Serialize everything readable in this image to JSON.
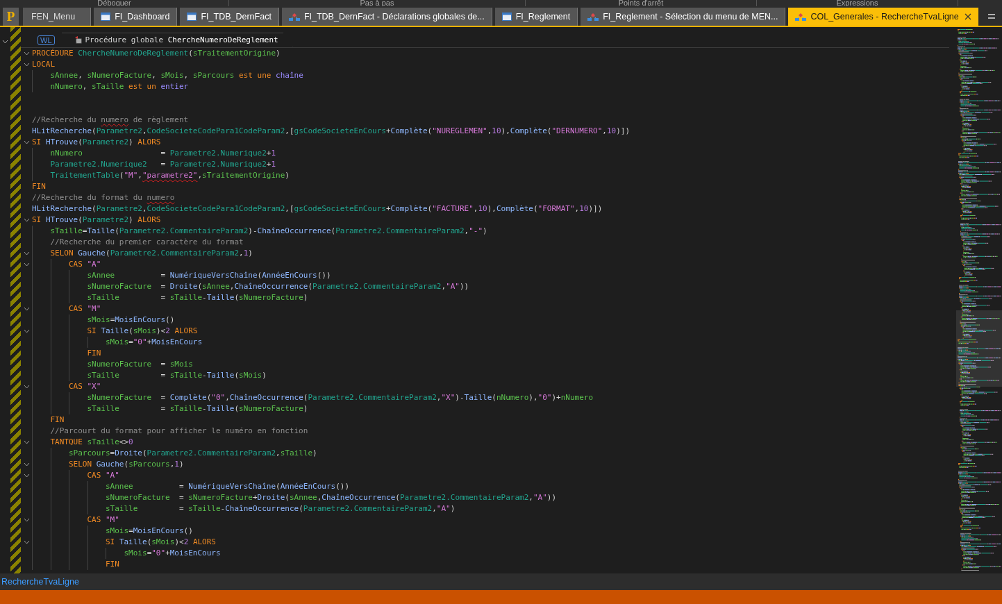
{
  "toolbar_groups": [
    {
      "label": "Déboguer"
    },
    {
      "label": "Pas à pas"
    },
    {
      "label": "Points d'arrêt"
    },
    {
      "label": "Expressions"
    }
  ],
  "app_logo": "P",
  "tabs": [
    {
      "label": "FEN_Menu",
      "kind": "plain",
      "selected": false
    },
    {
      "label": "FI_Dashboard",
      "kind": "window",
      "selected": false
    },
    {
      "label": "FI_TDB_DernFact",
      "kind": "window",
      "selected": false
    },
    {
      "label": "FI_TDB_DernFact - Déclarations globales de...",
      "kind": "code",
      "selected": false
    },
    {
      "label": "FI_Reglement",
      "kind": "window",
      "selected": false
    },
    {
      "label": "FI_Reglement - Sélection du menu de MEN...",
      "kind": "code",
      "selected": false
    },
    {
      "label": "COL_Generales - RechercheTvaLigne",
      "kind": "code",
      "selected": true
    }
  ],
  "editor": {
    "header": {
      "badge": "WL",
      "title": "Procédure globale **ChercheNumeroDeReglement**"
    },
    "lines": [
      {
        "foldable": true,
        "tokens": [
          {
            "kind": "kw",
            "text": "PROCÉDURE "
          },
          {
            "kind": "file",
            "text": "ChercheNumeroDeReglement"
          },
          {
            "kind": "p",
            "text": "("
          },
          {
            "kind": "var",
            "text": "sTraitementOrigine"
          },
          {
            "kind": "p",
            "text": ")"
          }
        ]
      },
      {
        "foldable": true,
        "tokens": [
          {
            "kind": "kw",
            "text": "LOCAL"
          }
        ],
        "children": [
          {
            "foldable": false,
            "tokens": [
              {
                "kind": "var",
                "text": "sAnnee"
              },
              {
                "kind": "p",
                "text": ", "
              },
              {
                "kind": "var",
                "text": "sNumeroFacture"
              },
              {
                "kind": "p",
                "text": ", "
              },
              {
                "kind": "var",
                "text": "sMois"
              },
              {
                "kind": "p",
                "text": ", "
              },
              {
                "kind": "var",
                "text": "sParcours "
              },
              {
                "kind": "kw",
                "text": "est une "
              },
              {
                "kind": "type",
                "text": "chaîne"
              }
            ]
          },
          {
            "foldable": false,
            "tokens": [
              {
                "kind": "var",
                "text": "nNumero"
              },
              {
                "kind": "p",
                "text": ", "
              },
              {
                "kind": "var",
                "text": "sTaille "
              },
              {
                "kind": "kw",
                "text": "est un "
              },
              {
                "kind": "type",
                "text": "entier"
              }
            ]
          }
        ]
      },
      {
        "foldable": false
      },
      {
        "foldable": false
      },
      {
        "foldable": false,
        "tokens": [
          {
            "kind": "comment",
            "text": "//Recherche du "
          },
          {
            "kind": "comment_typo",
            "text": "numero"
          },
          {
            "kind": "comment",
            "text": " de règlement"
          }
        ]
      },
      {
        "foldable": false,
        "tokens": [
          {
            "kind": "fn",
            "text": "HLitRecherche"
          },
          {
            "kind": "p",
            "text": "("
          },
          {
            "kind": "file",
            "text": "Parametre2"
          },
          {
            "kind": "p",
            "text": ","
          },
          {
            "kind": "file",
            "text": "CodeSocieteCodePara1CodeParam2"
          },
          {
            "kind": "p",
            "text": ",["
          },
          {
            "kind": "file",
            "text": "gsCodeSocieteEnCours"
          },
          {
            "kind": "p",
            "text": "+"
          },
          {
            "kind": "fn",
            "text": "Complète"
          },
          {
            "kind": "p",
            "text": "("
          },
          {
            "kind": "str",
            "text": "\"NUREGLEMEN\""
          },
          {
            "kind": "p",
            "text": ","
          },
          {
            "kind": "num",
            "text": "10"
          },
          {
            "kind": "p",
            "text": "),"
          },
          {
            "kind": "fn",
            "text": "Complète"
          },
          {
            "kind": "p",
            "text": "("
          },
          {
            "kind": "str",
            "text": "\"DERNUMERO\""
          },
          {
            "kind": "p",
            "text": ","
          },
          {
            "kind": "num",
            "text": "10"
          },
          {
            "kind": "p",
            "text": ")])"
          }
        ]
      },
      {
        "foldable": true,
        "tokens": [
          {
            "kind": "kw",
            "text": "SI "
          },
          {
            "kind": "fn",
            "text": "HTrouve"
          },
          {
            "kind": "p",
            "text": "("
          },
          {
            "kind": "file",
            "text": "Parametre2"
          },
          {
            "kind": "p",
            "text": ") "
          },
          {
            "kind": "kw",
            "text": "ALORS"
          }
        ],
        "children": [
          {
            "foldable": false,
            "tokens": [
              {
                "kind": "var",
                "text": "nNumero"
              },
              {
                "kind": "p",
                "text": "                 = "
              },
              {
                "kind": "file",
                "text": "Parametre2.Numerique2"
              },
              {
                "kind": "p",
                "text": "+"
              },
              {
                "kind": "num",
                "text": "1"
              }
            ]
          },
          {
            "foldable": false,
            "tokens": [
              {
                "kind": "file",
                "text": "Parametre2.Numerique2"
              },
              {
                "kind": "p",
                "text": "   = "
              },
              {
                "kind": "file",
                "text": "Parametre2.Numerique2"
              },
              {
                "kind": "p",
                "text": "+"
              },
              {
                "kind": "num",
                "text": "1"
              }
            ]
          },
          {
            "foldable": false,
            "tokens": [
              {
                "kind": "file",
                "text": "TraitementTable"
              },
              {
                "kind": "p",
                "text": "("
              },
              {
                "kind": "str",
                "text": "\"M\""
              },
              {
                "kind": "p",
                "text": ","
              },
              {
                "kind": "str_typo",
                "text": "\"parametre2\""
              },
              {
                "kind": "p",
                "text": ","
              },
              {
                "kind": "var",
                "text": "sTraitementOrigine"
              },
              {
                "kind": "p",
                "text": ")"
              }
            ]
          }
        ]
      },
      {
        "foldable": false,
        "tokens": [
          {
            "kind": "kw",
            "text": "FIN"
          }
        ]
      },
      {
        "foldable": false,
        "tokens": [
          {
            "kind": "comment",
            "text": "//Recherche du format du "
          },
          {
            "kind": "comment_typo",
            "text": "numero"
          }
        ]
      },
      {
        "foldable": false,
        "tokens": [
          {
            "kind": "fn",
            "text": "HLitRecherche"
          },
          {
            "kind": "p",
            "text": "("
          },
          {
            "kind": "file",
            "text": "Parametre2"
          },
          {
            "kind": "p",
            "text": ","
          },
          {
            "kind": "file",
            "text": "CodeSocieteCodePara1CodeParam2"
          },
          {
            "kind": "p",
            "text": ",["
          },
          {
            "kind": "file",
            "text": "gsCodeSocieteEnCours"
          },
          {
            "kind": "p",
            "text": "+"
          },
          {
            "kind": "fn",
            "text": "Complète"
          },
          {
            "kind": "p",
            "text": "("
          },
          {
            "kind": "str",
            "text": "\"FACTURE\""
          },
          {
            "kind": "p",
            "text": ","
          },
          {
            "kind": "num",
            "text": "10"
          },
          {
            "kind": "p",
            "text": "),"
          },
          {
            "kind": "fn",
            "text": "Complète"
          },
          {
            "kind": "p",
            "text": "("
          },
          {
            "kind": "str",
            "text": "\"FORMAT\""
          },
          {
            "kind": "p",
            "text": ","
          },
          {
            "kind": "num",
            "text": "10"
          },
          {
            "kind": "p",
            "text": ")])"
          }
        ]
      },
      {
        "foldable": true,
        "tokens": [
          {
            "kind": "kw",
            "text": "SI "
          },
          {
            "kind": "fn",
            "text": "HTrouve"
          },
          {
            "kind": "p",
            "text": "("
          },
          {
            "kind": "file",
            "text": "Parametre2"
          },
          {
            "kind": "p",
            "text": ") "
          },
          {
            "kind": "kw",
            "text": "ALORS"
          }
        ],
        "children": [
          {
            "foldable": false,
            "tokens": [
              {
                "kind": "var",
                "text": "sTaille"
              },
              {
                "kind": "p",
                "text": "="
              },
              {
                "kind": "fn",
                "text": "Taille"
              },
              {
                "kind": "p",
                "text": "("
              },
              {
                "kind": "file",
                "text": "Parametre2.CommentaireParam2"
              },
              {
                "kind": "p",
                "text": ")-"
              },
              {
                "kind": "fn",
                "text": "ChaîneOccurrence"
              },
              {
                "kind": "p",
                "text": "("
              },
              {
                "kind": "file",
                "text": "Parametre2.CommentaireParam2"
              },
              {
                "kind": "p",
                "text": ","
              },
              {
                "kind": "str",
                "text": "\"-\""
              },
              {
                "kind": "p",
                "text": ")"
              }
            ]
          },
          {
            "foldable": false,
            "tokens": [
              {
                "kind": "comment",
                "text": "//Recherche du premier caractère du format"
              }
            ]
          },
          {
            "foldable": true,
            "tokens": [
              {
                "kind": "kw",
                "text": "SELON "
              },
              {
                "kind": "fn",
                "text": "Gauche"
              },
              {
                "kind": "p",
                "text": "("
              },
              {
                "kind": "file",
                "text": "Parametre2.CommentaireParam2"
              },
              {
                "kind": "p",
                "text": ","
              },
              {
                "kind": "num",
                "text": "1"
              },
              {
                "kind": "p",
                "text": ")"
              }
            ],
            "children": [
              {
                "foldable": true,
                "tokens": [
                  {
                    "kind": "kw",
                    "text": "CAS "
                  },
                  {
                    "kind": "str",
                    "text": "\"A\""
                  }
                ],
                "children": [
                  {
                    "foldable": false,
                    "tokens": [
                      {
                        "kind": "var",
                        "text": "sAnnee"
                      },
                      {
                        "kind": "p",
                        "text": "          = "
                      },
                      {
                        "kind": "fn",
                        "text": "NumériqueVersChaîne"
                      },
                      {
                        "kind": "p",
                        "text": "("
                      },
                      {
                        "kind": "fn",
                        "text": "AnnéeEnCours"
                      },
                      {
                        "kind": "p",
                        "text": "())"
                      }
                    ]
                  },
                  {
                    "foldable": false,
                    "tokens": [
                      {
                        "kind": "var",
                        "text": "sNumeroFacture"
                      },
                      {
                        "kind": "p",
                        "text": "  = "
                      },
                      {
                        "kind": "fn",
                        "text": "Droite"
                      },
                      {
                        "kind": "p",
                        "text": "("
                      },
                      {
                        "kind": "var",
                        "text": "sAnnee"
                      },
                      {
                        "kind": "p",
                        "text": ","
                      },
                      {
                        "kind": "fn",
                        "text": "ChaîneOccurrence"
                      },
                      {
                        "kind": "p",
                        "text": "("
                      },
                      {
                        "kind": "file",
                        "text": "Parametre2.CommentaireParam2"
                      },
                      {
                        "kind": "p",
                        "text": ","
                      },
                      {
                        "kind": "str",
                        "text": "\"A\""
                      },
                      {
                        "kind": "p",
                        "text": "))"
                      }
                    ]
                  },
                  {
                    "foldable": false,
                    "tokens": [
                      {
                        "kind": "var",
                        "text": "sTaille"
                      },
                      {
                        "kind": "p",
                        "text": "         = "
                      },
                      {
                        "kind": "var",
                        "text": "sTaille"
                      },
                      {
                        "kind": "p",
                        "text": "-"
                      },
                      {
                        "kind": "fn",
                        "text": "Taille"
                      },
                      {
                        "kind": "p",
                        "text": "("
                      },
                      {
                        "kind": "var",
                        "text": "sNumeroFacture"
                      },
                      {
                        "kind": "p",
                        "text": ")"
                      }
                    ]
                  }
                ]
              },
              {
                "foldable": true,
                "tokens": [
                  {
                    "kind": "kw",
                    "text": "CAS "
                  },
                  {
                    "kind": "str",
                    "text": "\"M\""
                  }
                ],
                "children": [
                  {
                    "foldable": false,
                    "tokens": [
                      {
                        "kind": "var",
                        "text": "sMois"
                      },
                      {
                        "kind": "p",
                        "text": "="
                      },
                      {
                        "kind": "fn",
                        "text": "MoisEnCours"
                      },
                      {
                        "kind": "p",
                        "text": "()"
                      }
                    ]
                  },
                  {
                    "foldable": true,
                    "tokens": [
                      {
                        "kind": "kw",
                        "text": "SI "
                      },
                      {
                        "kind": "fn",
                        "text": "Taille"
                      },
                      {
                        "kind": "p",
                        "text": "("
                      },
                      {
                        "kind": "var",
                        "text": "sMois"
                      },
                      {
                        "kind": "p",
                        "text": ")<"
                      },
                      {
                        "kind": "num",
                        "text": "2 "
                      },
                      {
                        "kind": "kw",
                        "text": "ALORS"
                      }
                    ],
                    "children": [
                      {
                        "foldable": false,
                        "tokens": [
                          {
                            "kind": "var",
                            "text": "sMois"
                          },
                          {
                            "kind": "p",
                            "text": "="
                          },
                          {
                            "kind": "str",
                            "text": "\"0\""
                          },
                          {
                            "kind": "p",
                            "text": "+"
                          },
                          {
                            "kind": "fn",
                            "text": "MoisEnCours"
                          }
                        ]
                      }
                    ]
                  },
                  {
                    "foldable": false,
                    "tokens": [
                      {
                        "kind": "kw",
                        "text": "FIN"
                      }
                    ]
                  },
                  {
                    "foldable": false,
                    "tokens": [
                      {
                        "kind": "var",
                        "text": "sNumeroFacture"
                      },
                      {
                        "kind": "p",
                        "text": "  = "
                      },
                      {
                        "kind": "var",
                        "text": "sMois"
                      }
                    ]
                  },
                  {
                    "foldable": false,
                    "tokens": [
                      {
                        "kind": "var",
                        "text": "sTaille"
                      },
                      {
                        "kind": "p",
                        "text": "         = "
                      },
                      {
                        "kind": "var",
                        "text": "sTaille"
                      },
                      {
                        "kind": "p",
                        "text": "-"
                      },
                      {
                        "kind": "fn",
                        "text": "Taille"
                      },
                      {
                        "kind": "p",
                        "text": "("
                      },
                      {
                        "kind": "var",
                        "text": "sMois"
                      },
                      {
                        "kind": "p",
                        "text": ")"
                      }
                    ]
                  }
                ]
              },
              {
                "foldable": true,
                "tokens": [
                  {
                    "kind": "kw",
                    "text": "CAS "
                  },
                  {
                    "kind": "str",
                    "text": "\"X\""
                  }
                ],
                "children": [
                  {
                    "foldable": false,
                    "tokens": [
                      {
                        "kind": "var",
                        "text": "sNumeroFacture"
                      },
                      {
                        "kind": "p",
                        "text": "  = "
                      },
                      {
                        "kind": "fn",
                        "text": "Complète"
                      },
                      {
                        "kind": "p",
                        "text": "("
                      },
                      {
                        "kind": "str",
                        "text": "\"0\""
                      },
                      {
                        "kind": "p",
                        "text": ","
                      },
                      {
                        "kind": "fn",
                        "text": "ChaîneOccurrence"
                      },
                      {
                        "kind": "p",
                        "text": "("
                      },
                      {
                        "kind": "file",
                        "text": "Parametre2.CommentaireParam2"
                      },
                      {
                        "kind": "p",
                        "text": ","
                      },
                      {
                        "kind": "str",
                        "text": "\"X\""
                      },
                      {
                        "kind": "p",
                        "text": ")-"
                      },
                      {
                        "kind": "fn",
                        "text": "Taille"
                      },
                      {
                        "kind": "p",
                        "text": "("
                      },
                      {
                        "kind": "var",
                        "text": "nNumero"
                      },
                      {
                        "kind": "p",
                        "text": "),"
                      },
                      {
                        "kind": "str",
                        "text": "\"0\""
                      },
                      {
                        "kind": "p",
                        "text": ")+"
                      },
                      {
                        "kind": "var",
                        "text": "nNumero"
                      }
                    ]
                  },
                  {
                    "foldable": false,
                    "tokens": [
                      {
                        "kind": "var",
                        "text": "sTaille"
                      },
                      {
                        "kind": "p",
                        "text": "         = "
                      },
                      {
                        "kind": "var",
                        "text": "sTaille"
                      },
                      {
                        "kind": "p",
                        "text": "-"
                      },
                      {
                        "kind": "fn",
                        "text": "Taille"
                      },
                      {
                        "kind": "p",
                        "text": "("
                      },
                      {
                        "kind": "var",
                        "text": "sNumeroFacture"
                      },
                      {
                        "kind": "p",
                        "text": ")"
                      }
                    ]
                  }
                ]
              }
            ]
          },
          {
            "foldable": false,
            "tokens": [
              {
                "kind": "kw",
                "text": "FIN"
              }
            ]
          },
          {
            "foldable": false,
            "tokens": [
              {
                "kind": "comment",
                "text": "//Parcourt du format pour afficher le numéro en fonction"
              }
            ]
          },
          {
            "foldable": true,
            "tokens": [
              {
                "kind": "kw",
                "text": "TANTQUE "
              },
              {
                "kind": "var",
                "text": "sTaille"
              },
              {
                "kind": "p",
                "text": "<>"
              },
              {
                "kind": "num",
                "text": "0"
              }
            ],
            "children": [
              {
                "foldable": false,
                "tokens": [
                  {
                    "kind": "var",
                    "text": "sParcours"
                  },
                  {
                    "kind": "p",
                    "text": "="
                  },
                  {
                    "kind": "fn",
                    "text": "Droite"
                  },
                  {
                    "kind": "p",
                    "text": "("
                  },
                  {
                    "kind": "file",
                    "text": "Parametre2.CommentaireParam2"
                  },
                  {
                    "kind": "p",
                    "text": ","
                  },
                  {
                    "kind": "var",
                    "text": "sTaille"
                  },
                  {
                    "kind": "p",
                    "text": ")"
                  }
                ]
              },
              {
                "foldable": true,
                "tokens": [
                  {
                    "kind": "kw",
                    "text": "SELON "
                  },
                  {
                    "kind": "fn",
                    "text": "Gauche"
                  },
                  {
                    "kind": "p",
                    "text": "("
                  },
                  {
                    "kind": "var",
                    "text": "sParcours"
                  },
                  {
                    "kind": "p",
                    "text": ","
                  },
                  {
                    "kind": "num",
                    "text": "1"
                  },
                  {
                    "kind": "p",
                    "text": ")"
                  }
                ],
                "children": [
                  {
                    "foldable": true,
                    "tokens": [
                      {
                        "kind": "kw",
                        "text": "CAS "
                      },
                      {
                        "kind": "str",
                        "text": "\"A\""
                      }
                    ],
                    "children": [
                      {
                        "foldable": false,
                        "tokens": [
                          {
                            "kind": "var",
                            "text": "sAnnee"
                          },
                          {
                            "kind": "p",
                            "text": "          = "
                          },
                          {
                            "kind": "fn",
                            "text": "NumériqueVersChaîne"
                          },
                          {
                            "kind": "p",
                            "text": "("
                          },
                          {
                            "kind": "fn",
                            "text": "AnnéeEnCours"
                          },
                          {
                            "kind": "p",
                            "text": "())"
                          }
                        ]
                      },
                      {
                        "foldable": false,
                        "tokens": [
                          {
                            "kind": "var",
                            "text": "sNumeroFacture"
                          },
                          {
                            "kind": "p",
                            "text": "  = "
                          },
                          {
                            "kind": "var",
                            "text": "sNumeroFacture"
                          },
                          {
                            "kind": "p",
                            "text": "+"
                          },
                          {
                            "kind": "fn",
                            "text": "Droite"
                          },
                          {
                            "kind": "p",
                            "text": "("
                          },
                          {
                            "kind": "var",
                            "text": "sAnnee"
                          },
                          {
                            "kind": "p",
                            "text": ","
                          },
                          {
                            "kind": "fn",
                            "text": "ChaîneOccurrence"
                          },
                          {
                            "kind": "p",
                            "text": "("
                          },
                          {
                            "kind": "file",
                            "text": "Parametre2.CommentaireParam2"
                          },
                          {
                            "kind": "p",
                            "text": ","
                          },
                          {
                            "kind": "str",
                            "text": "\"A\""
                          },
                          {
                            "kind": "p",
                            "text": "))"
                          }
                        ]
                      },
                      {
                        "foldable": false,
                        "tokens": [
                          {
                            "kind": "var",
                            "text": "sTaille"
                          },
                          {
                            "kind": "p",
                            "text": "         = "
                          },
                          {
                            "kind": "var",
                            "text": "sTaille"
                          },
                          {
                            "kind": "p",
                            "text": "-"
                          },
                          {
                            "kind": "fn",
                            "text": "ChaîneOccurrence"
                          },
                          {
                            "kind": "p",
                            "text": "("
                          },
                          {
                            "kind": "file",
                            "text": "Parametre2.CommentaireParam2"
                          },
                          {
                            "kind": "p",
                            "text": ","
                          },
                          {
                            "kind": "str",
                            "text": "\"A\""
                          },
                          {
                            "kind": "p",
                            "text": ")"
                          }
                        ]
                      }
                    ]
                  },
                  {
                    "foldable": true,
                    "tokens": [
                      {
                        "kind": "kw",
                        "text": "CAS "
                      },
                      {
                        "kind": "str",
                        "text": "\"M\""
                      }
                    ],
                    "children": [
                      {
                        "foldable": false,
                        "tokens": [
                          {
                            "kind": "var",
                            "text": "sMois"
                          },
                          {
                            "kind": "p",
                            "text": "="
                          },
                          {
                            "kind": "fn",
                            "text": "MoisEnCours"
                          },
                          {
                            "kind": "p",
                            "text": "()"
                          }
                        ]
                      },
                      {
                        "foldable": true,
                        "tokens": [
                          {
                            "kind": "kw",
                            "text": "SI "
                          },
                          {
                            "kind": "fn",
                            "text": "Taille"
                          },
                          {
                            "kind": "p",
                            "text": "("
                          },
                          {
                            "kind": "var",
                            "text": "sMois"
                          },
                          {
                            "kind": "p",
                            "text": ")<"
                          },
                          {
                            "kind": "num",
                            "text": "2 "
                          },
                          {
                            "kind": "kw",
                            "text": "ALORS"
                          }
                        ],
                        "children": [
                          {
                            "foldable": false,
                            "tokens": [
                              {
                                "kind": "var",
                                "text": "sMois"
                              },
                              {
                                "kind": "p",
                                "text": "="
                              },
                              {
                                "kind": "str",
                                "text": "\"0\""
                              },
                              {
                                "kind": "p",
                                "text": "+"
                              },
                              {
                                "kind": "fn",
                                "text": "MoisEnCours"
                              }
                            ]
                          }
                        ]
                      },
                      {
                        "foldable": false,
                        "tokens": [
                          {
                            "kind": "kw",
                            "text": "FIN"
                          }
                        ]
                      }
                    ]
                  }
                ]
              }
            ]
          }
        ]
      }
    ]
  },
  "status_bar": {
    "text": "RechercheTvaLigne"
  }
}
